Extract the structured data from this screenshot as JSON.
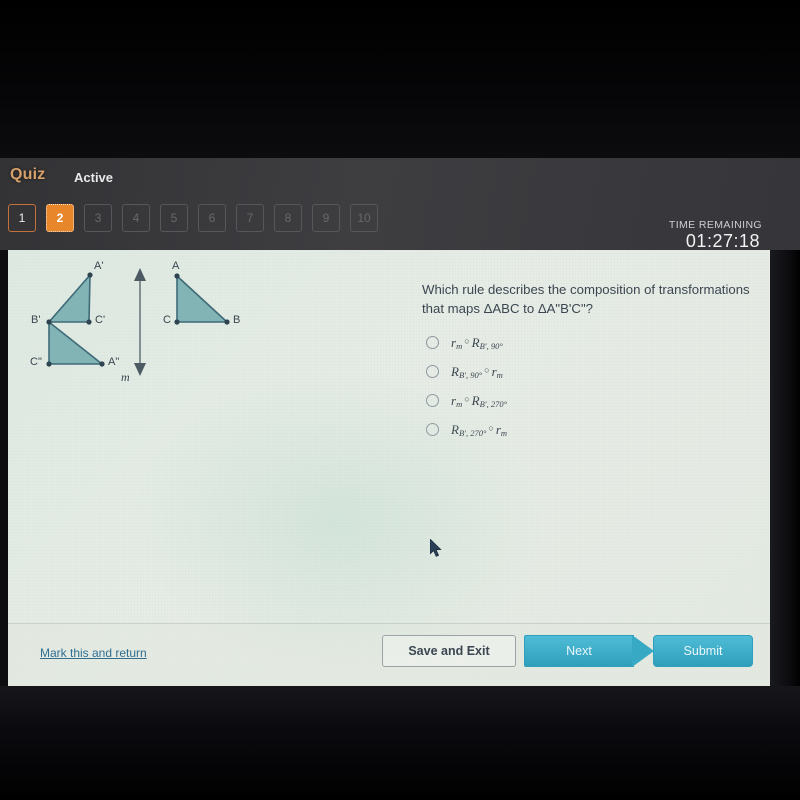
{
  "header": {
    "quiz_label": "Quiz",
    "status_label": "Active",
    "time_remaining_label": "TIME REMAINING",
    "time_remaining_value": "01:27:18"
  },
  "question_tabs": [
    {
      "number": "1",
      "state": "visited"
    },
    {
      "number": "2",
      "state": "current"
    },
    {
      "number": "3",
      "state": "locked"
    },
    {
      "number": "4",
      "state": "locked"
    },
    {
      "number": "5",
      "state": "locked"
    },
    {
      "number": "6",
      "state": "locked"
    },
    {
      "number": "7",
      "state": "locked"
    },
    {
      "number": "8",
      "state": "locked"
    },
    {
      "number": "9",
      "state": "locked"
    },
    {
      "number": "10",
      "state": "locked"
    }
  ],
  "question": {
    "line1": "Which rule describes the composition of transformations",
    "line2": "that maps ΔABC to ΔA\"B'C\"?"
  },
  "options": [
    {
      "id": "a",
      "first_symbol": "r",
      "first_sub": "m",
      "second_symbol": "R",
      "second_sub": "B', 90°",
      "selected": false
    },
    {
      "id": "b",
      "first_symbol": "R",
      "first_sub": "B', 90°",
      "second_symbol": "r",
      "second_sub": "m",
      "selected": false
    },
    {
      "id": "c",
      "first_symbol": "r",
      "first_sub": "m",
      "second_symbol": "R",
      "second_sub": "B', 270°",
      "selected": false
    },
    {
      "id": "d",
      "first_symbol": "R",
      "first_sub": "B', 270°",
      "second_symbol": "r",
      "second_sub": "m",
      "selected": false
    }
  ],
  "compose_operator": "○",
  "figure": {
    "line_label": "m",
    "vertex_labels": {
      "a_prime": "A'",
      "b_prime": "B'",
      "c_prime": "C'",
      "c_double_prime": "C\"",
      "a_double_prime": "A\"",
      "a": "A",
      "b": "B",
      "c": "C"
    },
    "triangle_fill": "#78aeb0",
    "triangle_stroke": "#3f6b78"
  },
  "footer": {
    "mark_link": "Mark this and return",
    "save_button": "Save and Exit",
    "next_button": "Next",
    "submit_button": "Submit"
  },
  "colors": {
    "accent_orange": "#e8862b",
    "teal_button": "#3daec9",
    "link_blue": "#2f6e91",
    "header_dark": "#3a3a3c"
  }
}
